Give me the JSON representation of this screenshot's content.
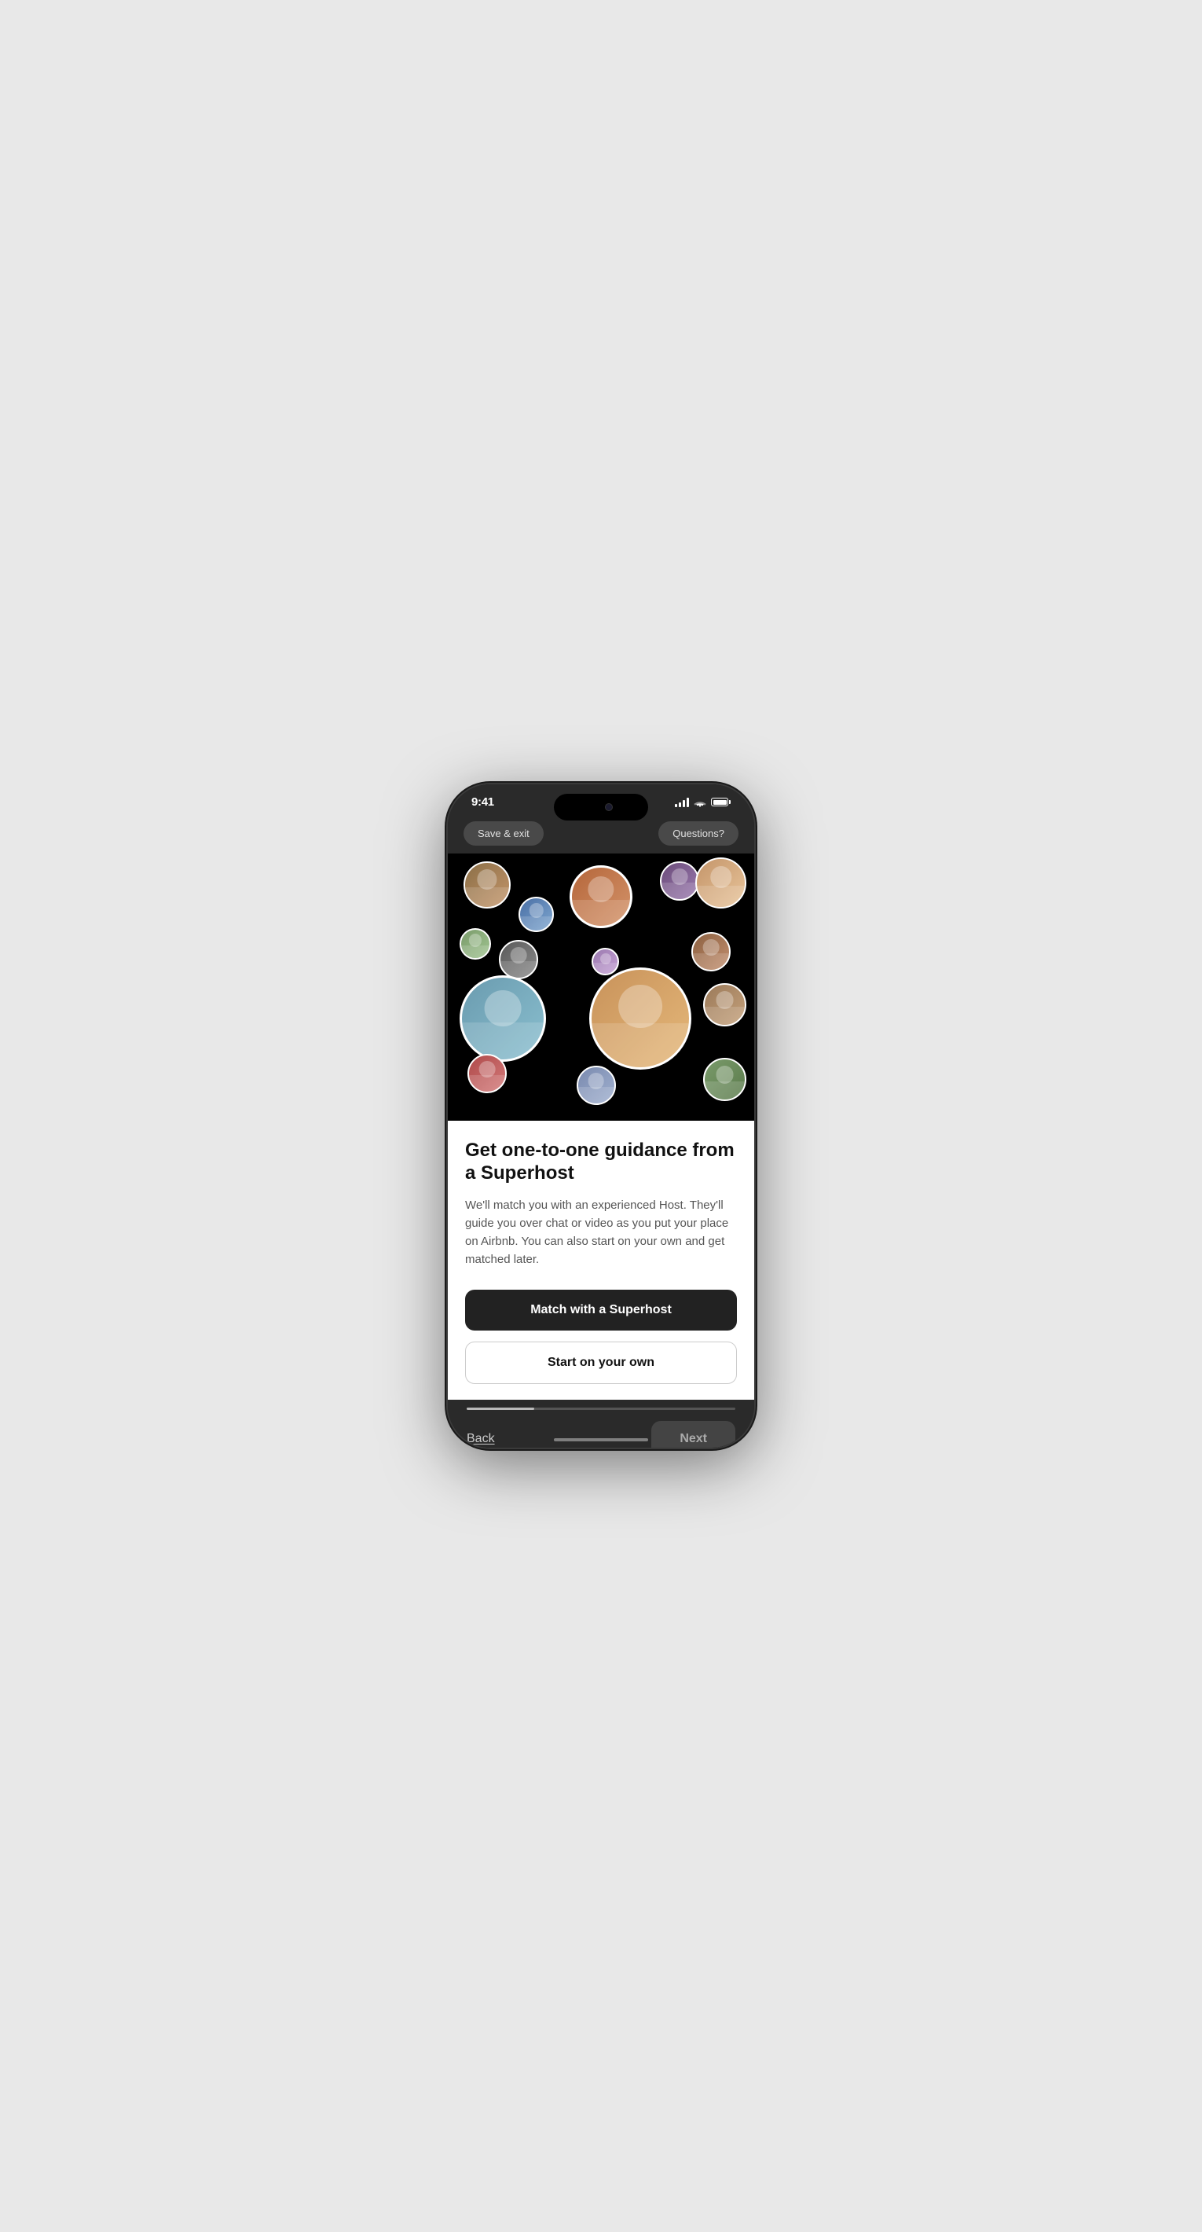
{
  "status_bar": {
    "time": "9:41",
    "signal_label": "signal bars",
    "wifi_label": "wifi",
    "battery_label": "battery"
  },
  "top_nav": {
    "save_exit_label": "Save & exit",
    "questions_label": "Questions?"
  },
  "hero": {
    "avatars_description": "Various Superhost profile photos arranged in floating circles on dark background"
  },
  "content": {
    "title": "Get one-to-one guidance from a Superhost",
    "description": "We'll match you with an experienced Host. They'll guide you over chat or video as you put your place on Airbnb. You can also start on your own and get matched later.",
    "primary_button": "Match with a Superhost",
    "secondary_button": "Start on your own"
  },
  "bottom_nav": {
    "back_label": "Back",
    "next_label": "Next"
  },
  "colors": {
    "primary_bg": "#000000",
    "content_bg": "#ffffff",
    "phone_frame": "#1a1a1a",
    "btn_primary_bg": "#222222",
    "btn_secondary_border": "#cccccc"
  }
}
